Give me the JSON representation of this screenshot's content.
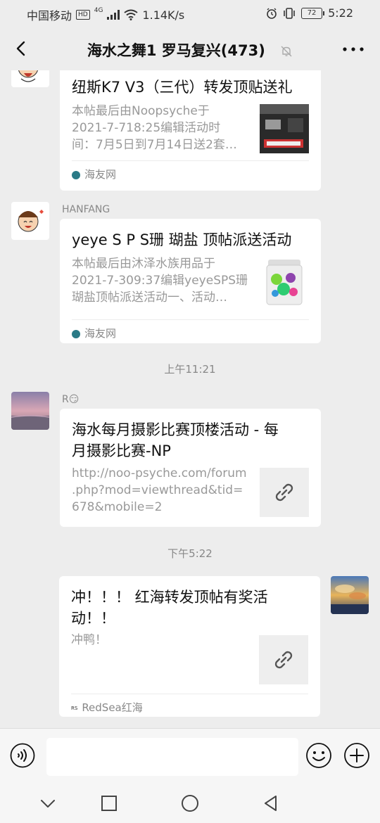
{
  "status_bar": {
    "carrier": "中国移动",
    "hd": "HD",
    "network": "4G",
    "speed": "1.14K/s",
    "battery": "72",
    "time": "5:22"
  },
  "header": {
    "title": "海水之舞1 罗马复兴(473)"
  },
  "messages": [
    {
      "card_title": "纽斯K7 V3（三代）转发顶贴送礼",
      "desc_lines": [
        "本帖最后由Noopsyche于",
        "2021-7-718:25编辑活动时",
        "间：7月5日到7月14日送2套…"
      ],
      "source": "海友网"
    },
    {
      "sender": "HANFANG",
      "card_title": "yeye S P S珊 瑚盐 顶帖派送活动",
      "desc_lines": [
        "本帖最后由沐泽水族用品于",
        "2021-7-309:37编辑yeyeSPS珊",
        "瑚盐顶帖派送活动一、活动…"
      ],
      "source": "海友网"
    },
    {
      "time": "上午11:21"
    },
    {
      "sender": "R😏",
      "card_title_lines": [
        "海水每月摄影比赛顶楼活动 - 每",
        "月摄影比赛-NP"
      ],
      "desc_lines": [
        "http://noo-psyche.com/forum",
        ".php?mod=viewthread&tid=",
        "678&mobile=2"
      ]
    },
    {
      "time": "下午5:22"
    },
    {
      "card_title_lines": [
        "冲！！！ 红海转发顶帖有奖活",
        "动！！"
      ],
      "desc": "冲鸭！",
      "source": "RedSea红海",
      "source_logo": "RS"
    }
  ],
  "colors": {
    "background": "#ededed",
    "card": "#ffffff",
    "muted_text": "#999999"
  }
}
